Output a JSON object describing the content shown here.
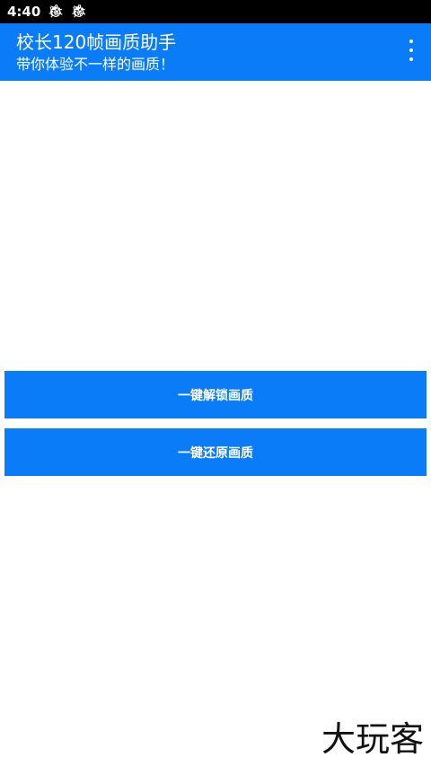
{
  "status_bar": {
    "time": "4:40",
    "icons": [
      "bug-icon",
      "bug-icon"
    ]
  },
  "app_bar": {
    "title": "校长120帧画质助手",
    "subtitle": "带你体验不一样的画质！",
    "menu_icon": "more-vert-icon"
  },
  "actions": {
    "unlock_label": "一键解锁画质",
    "restore_label": "一键还原画质"
  },
  "watermark": {
    "text": "大玩客"
  },
  "colors": {
    "primary": "#0a7cf7",
    "status_bar": "#000000",
    "background": "#ffffff"
  }
}
